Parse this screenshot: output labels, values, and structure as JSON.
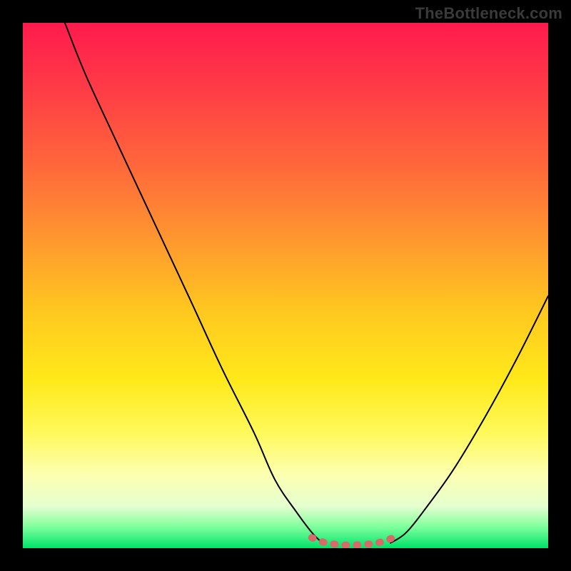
{
  "watermark": "TheBottleneck.com",
  "colors": {
    "frame_background": "#000000",
    "watermark_text": "#3a3a3a",
    "curve_stroke": "#000000",
    "marker_stroke": "#d86a6a",
    "gradient_top": "#ff1a4d",
    "gradient_bottom": "#00e36a"
  },
  "chart_data": {
    "type": "line",
    "title": "",
    "xlabel": "",
    "ylabel": "",
    "xlim": [
      0,
      100
    ],
    "ylim": [
      0,
      100
    ],
    "grid": false,
    "legend": false,
    "annotations": [],
    "series": [
      {
        "name": "left-curve",
        "x": [
          8,
          12,
          18,
          25,
          32,
          38,
          44,
          48,
          52,
          55,
          57
        ],
        "values": [
          100,
          90,
          77,
          62,
          47,
          34,
          22,
          13,
          7,
          3,
          1
        ]
      },
      {
        "name": "right-curve",
        "x": [
          70,
          73,
          77,
          82,
          88,
          94,
          100
        ],
        "values": [
          1,
          3,
          8,
          15,
          25,
          36,
          48
        ]
      },
      {
        "name": "flat-region-marker",
        "x": [
          55,
          57,
          59,
          61,
          63,
          65,
          67,
          69,
          71
        ],
        "values": [
          2,
          1.2,
          0.8,
          0.6,
          0.6,
          0.7,
          0.9,
          1.4,
          2.2
        ]
      }
    ],
    "background_gradient": {
      "orientation": "vertical",
      "stops": [
        {
          "pos": 0.0,
          "color": "#ff1a4d"
        },
        {
          "pos": 0.12,
          "color": "#ff3a47"
        },
        {
          "pos": 0.28,
          "color": "#ff6a3a"
        },
        {
          "pos": 0.42,
          "color": "#ff9a2e"
        },
        {
          "pos": 0.55,
          "color": "#ffc81f"
        },
        {
          "pos": 0.68,
          "color": "#ffe91a"
        },
        {
          "pos": 0.78,
          "color": "#fff95a"
        },
        {
          "pos": 0.86,
          "color": "#fcffb0"
        },
        {
          "pos": 0.92,
          "color": "#e6ffd0"
        },
        {
          "pos": 0.96,
          "color": "#7dff9c"
        },
        {
          "pos": 1.0,
          "color": "#00e36a"
        }
      ]
    }
  }
}
